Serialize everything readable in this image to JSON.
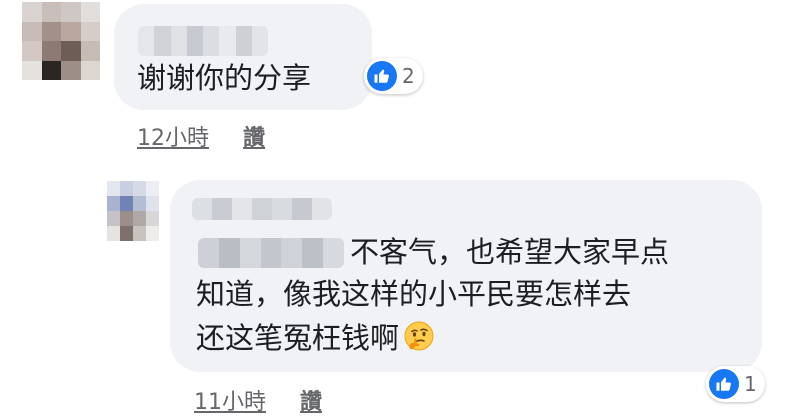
{
  "comments": [
    {
      "text": "谢谢你的分享",
      "reaction_icon": "like-icon",
      "reaction_count": "2",
      "timestamp": "12小時",
      "like_label": "讚"
    },
    {
      "lines": [
        "不客气，也希望大家早点",
        "知道，像我这样的小平民要怎样去",
        "还这笔冤枉钱啊"
      ],
      "emoji": "thinking-face-emoji",
      "reaction_icon": "like-icon",
      "reaction_count": "1",
      "timestamp": "11小時",
      "like_label": "讚"
    }
  ],
  "colors": {
    "bubble": "#f0f2f5",
    "like_blue": "#1877f2",
    "meta_text": "#65676b",
    "text": "#1c1e21"
  }
}
